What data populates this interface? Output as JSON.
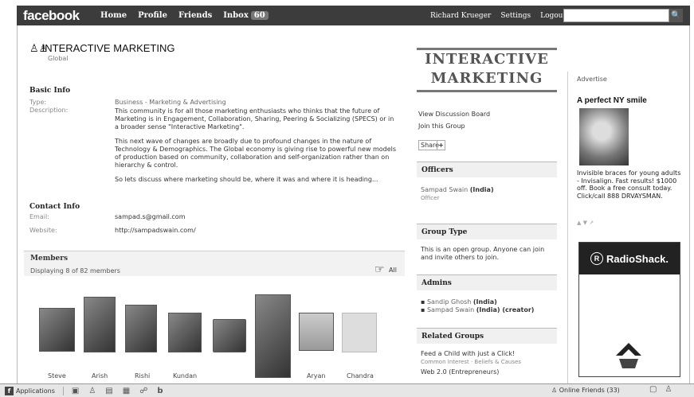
{
  "topbar": {
    "logo": "facebook",
    "nav": [
      "Home",
      "Profile",
      "Friends",
      "Inbox"
    ],
    "inbox_count": "60",
    "user": "Richard Krueger",
    "settings": "Settings",
    "logout": "Logout",
    "search_placeholder": ""
  },
  "group": {
    "title": "INTERACTIVE MARKETING",
    "scope": "Global"
  },
  "basic_info": {
    "heading": "Basic Info",
    "type_label": "Type:",
    "type_value": "Business - Marketing & Advertising",
    "desc_label": "Description:",
    "desc_p1": "This community is for all those marketing enthusiasts who thinks that the future of Marketing is in Engagement, Collaboration, Sharing, Peering & Socializing (SPECS) or in a broader sense \"Interactive Marketing\".",
    "desc_p2": "This next wave of changes are broadly due to profound changes in the nature of Technology & Demographics. The Global economy is giving rise to powerful new models of production based on community, collaboration and self-organization rather than on hierarchy & control.",
    "desc_p3": "So lets discuss where marketing should be, where it was and where it is heading..."
  },
  "contact_info": {
    "heading": "Contact Info",
    "email_label": "Email:",
    "email": "sampad.s@gmail.com",
    "website_label": "Website:",
    "website": "http://sampadswain.com/"
  },
  "members": {
    "heading": "Members",
    "displaying": "Displaying 8 of 82 members",
    "see_all": "All",
    "names": [
      "Steve",
      "Arish",
      "Rishi",
      "Kundan",
      "",
      "",
      "Aryan",
      "Chandra"
    ]
  },
  "middle": {
    "banner_line1": "INTERACTIVE",
    "banner_line2": "MARKETING",
    "view_board": "View Discussion Board",
    "join": "Join this Group",
    "share": "Share",
    "share_plus": "+",
    "officers_h": "Officers",
    "officer_name": "Sampad Swain",
    "officer_country": "(India)",
    "officer_role": "Officer",
    "group_type_h": "Group Type",
    "group_type_text": "This is an open group. Anyone can join and invite others to join.",
    "admins_h": "Admins",
    "admin1_name": "Sandip Ghosh",
    "admin1_extra": "(India)",
    "admin2_name": "Sampad Swain",
    "admin2_extra": "(India) (creator)",
    "related_h": "Related Groups",
    "related1": "Feed a Child with just a Click!",
    "related1_sub": "Common Interest · Beliefs & Causes",
    "related2": "Web 2.0 (Entrepreneurs)"
  },
  "ad": {
    "heading": "Advertise",
    "title": "A perfect NY smile",
    "text": "Invisible braces for young adults - Invisalign. Fast results! $1000 off. Book a free consult today. Click/call 888 DRVAYSMAN.",
    "radioshack": "RadioShack.",
    "rs_r": "R"
  },
  "bottombar": {
    "applications": "Applications",
    "fb": "f",
    "online_friends": "Online Friends (33)"
  }
}
